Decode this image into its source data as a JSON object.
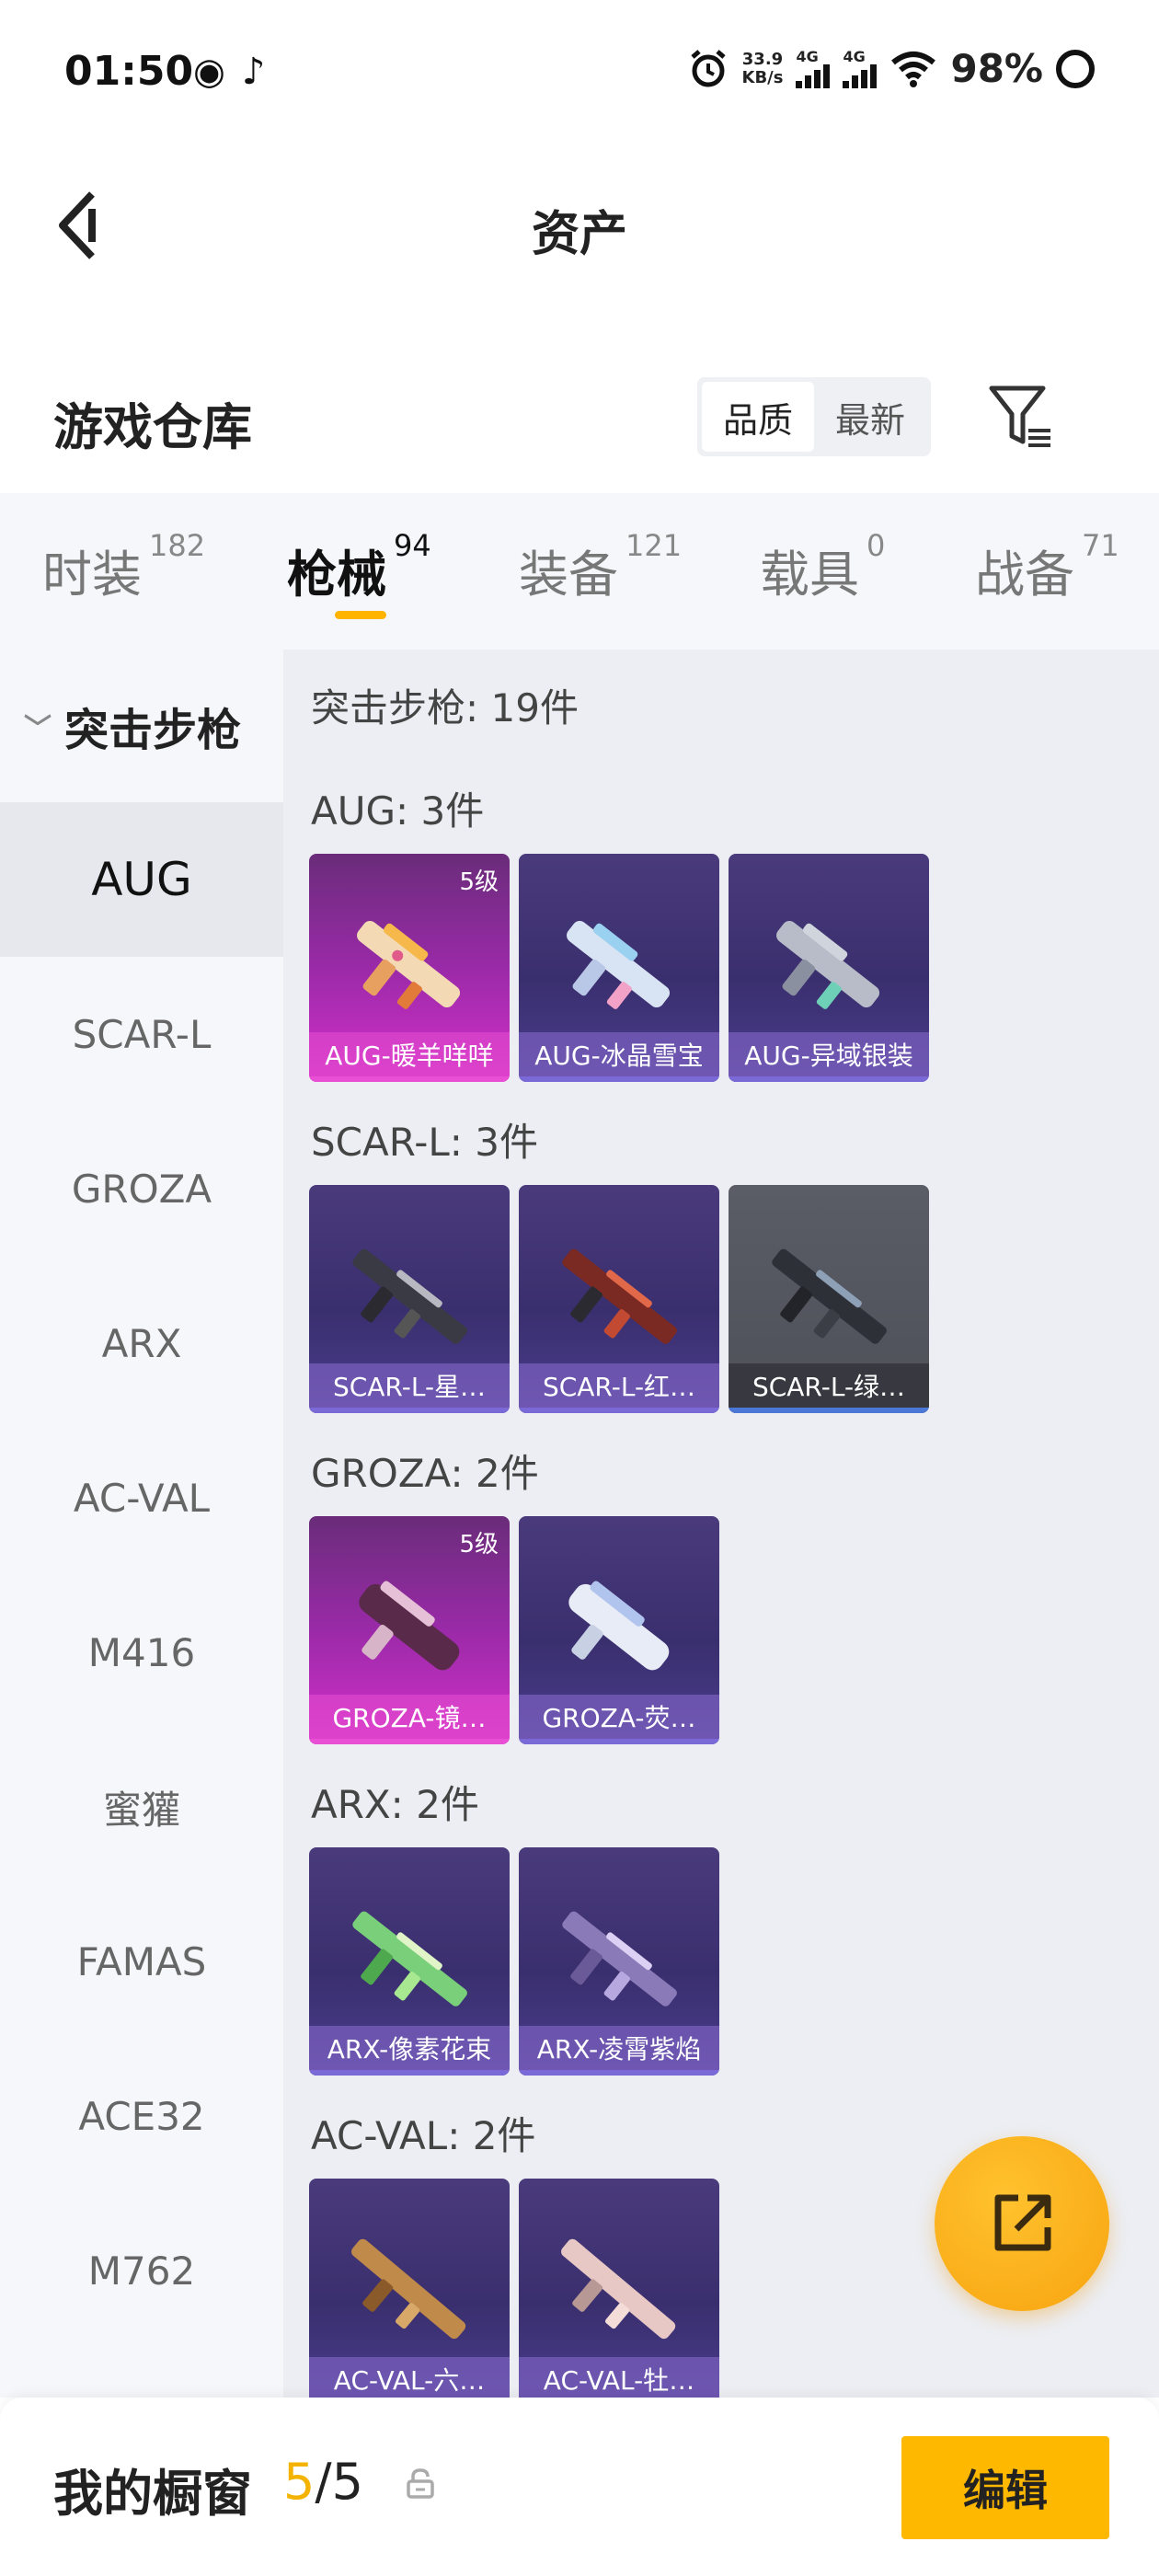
{
  "status_bar": {
    "time": "01:50",
    "speed_value": "33.9",
    "speed_unit": "KB/s",
    "net1": "4G",
    "net2": "4G",
    "battery": "98%"
  },
  "header": {
    "title": "资产"
  },
  "warehouse": {
    "title": "游戏仓库",
    "sort_options": [
      "品质",
      "最新"
    ],
    "sort_selected": "品质"
  },
  "category_tabs": [
    {
      "label": "时装",
      "count": "182"
    },
    {
      "label": "枪械",
      "count": "94",
      "active": true
    },
    {
      "label": "装备",
      "count": "121"
    },
    {
      "label": "载具",
      "count": "0"
    },
    {
      "label": "战备",
      "count": "71"
    }
  ],
  "sidebar": {
    "group": "突击步枪",
    "items": [
      "AUG",
      "SCAR-L",
      "GROZA",
      "ARX",
      "AC-VAL",
      "M416",
      "蜜獾",
      "FAMAS",
      "ACE32",
      "M762"
    ],
    "selected": "AUG"
  },
  "main": {
    "summary": "突击步枪: 19件",
    "groups": [
      {
        "title": "AUG: 3件",
        "items": [
          {
            "name": "AUG-暖羊咩咩",
            "level": "5级",
            "style": "pink"
          },
          {
            "name": "AUG-冰晶雪宝",
            "level": "",
            "style": "purple"
          },
          {
            "name": "AUG-异域银装",
            "level": "",
            "style": "purple"
          }
        ]
      },
      {
        "title": "SCAR-L: 3件",
        "items": [
          {
            "name": "SCAR-L-星…",
            "level": "",
            "style": "purple"
          },
          {
            "name": "SCAR-L-红…",
            "level": "",
            "style": "purple"
          },
          {
            "name": "SCAR-L-绿…",
            "level": "",
            "style": "grey"
          }
        ]
      },
      {
        "title": "GROZA: 2件",
        "items": [
          {
            "name": "GROZA-镜…",
            "level": "5级",
            "style": "pink"
          },
          {
            "name": "GROZA-荧…",
            "level": "",
            "style": "purple"
          }
        ]
      },
      {
        "title": "ARX: 2件",
        "items": [
          {
            "name": "ARX-像素花束",
            "level": "",
            "style": "purple"
          },
          {
            "name": "ARX-凌霄紫焰",
            "level": "",
            "style": "purple"
          }
        ]
      },
      {
        "title": "AC-VAL: 2件",
        "items": [
          {
            "name": "AC-VAL-六…",
            "level": "",
            "style": "purple"
          },
          {
            "name": "AC-VAL-牡…",
            "level": "",
            "style": "purple"
          }
        ]
      }
    ]
  },
  "bottom_bar": {
    "label": "我的橱窗",
    "current": "5",
    "separator": "/",
    "total": "5",
    "edit_label": "编辑"
  },
  "colors": {
    "accent": "#ffb800",
    "rare_pink": "#d430c8",
    "card_purple": "#3a2f6e",
    "card_grey": "#54565e"
  }
}
